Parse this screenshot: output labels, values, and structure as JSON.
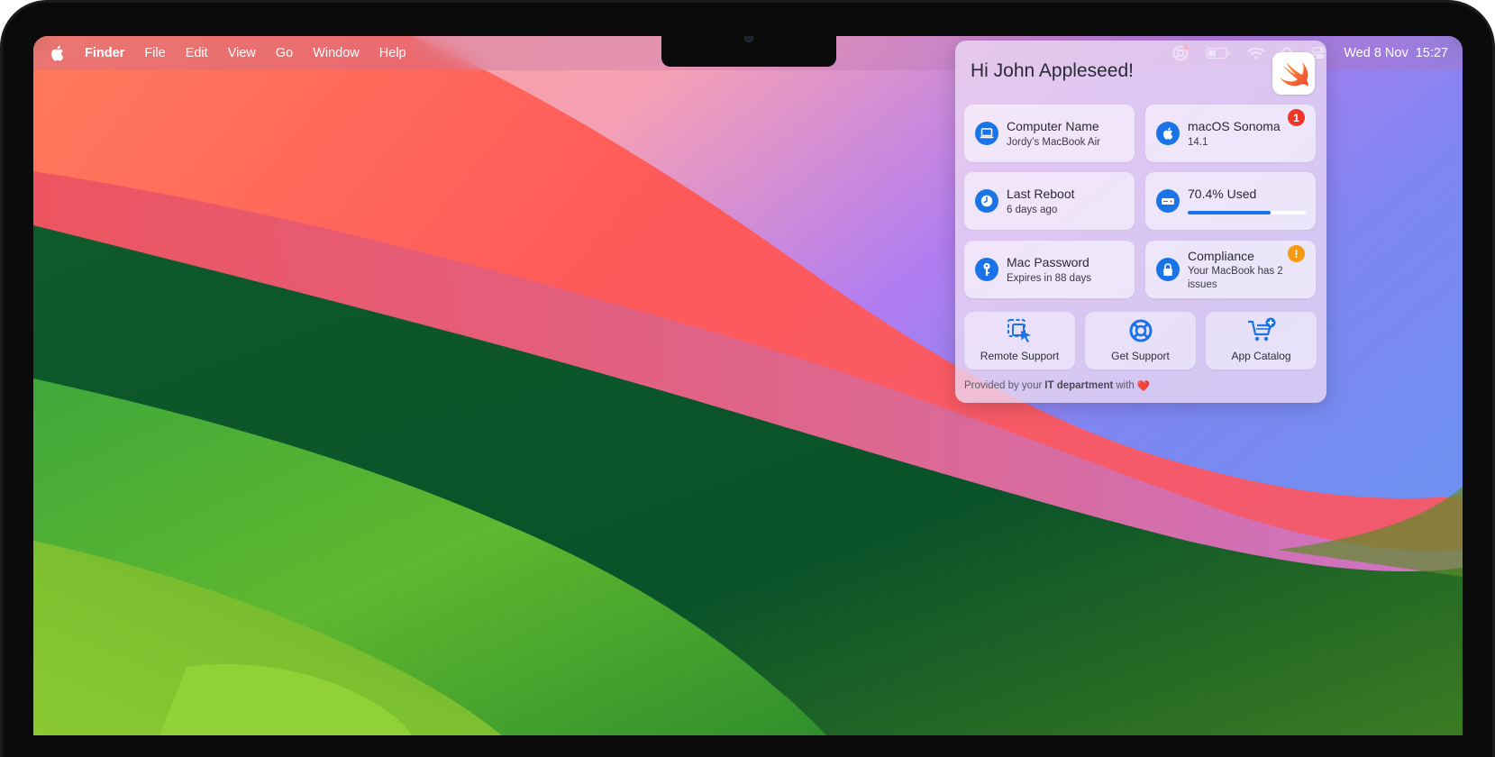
{
  "menubar": {
    "items": [
      "Finder",
      "File",
      "Edit",
      "View",
      "Go",
      "Window",
      "Help"
    ],
    "date": "Wed 8 Nov",
    "time": "15:27",
    "icons": [
      "apple-icon",
      "support-lifebuoy-icon",
      "battery-icon",
      "wifi-icon",
      "search-icon",
      "control-center-icon"
    ]
  },
  "panel": {
    "greeting": "Hi John Appleseed!",
    "logo_icon": "swift-icon",
    "cards": [
      {
        "title": "Computer Name",
        "subtitle": "Jordy’s MacBook Air",
        "icon": "laptop-icon"
      },
      {
        "title": "macOS Sonoma",
        "subtitle": "14.1",
        "icon": "apple-icon",
        "badge": "1"
      },
      {
        "title": "Last Reboot",
        "subtitle": "6 days ago",
        "icon": "clock-icon"
      },
      {
        "title": "70.4% Used",
        "icon": "storage-drive-icon",
        "usage": 0.704
      },
      {
        "title": "Mac Password",
        "subtitle": "Expires in 88 days",
        "icon": "key-icon"
      },
      {
        "title": "Compliance",
        "subtitle": "Your MacBook has 2 issues",
        "icon": "lock-icon",
        "badge": "!"
      }
    ],
    "actions": [
      {
        "label": "Remote Support",
        "icon": "remote-support-icon"
      },
      {
        "label": "Get Support",
        "icon": "lifebuoy-icon"
      },
      {
        "label": "App Catalog",
        "icon": "cart-plus-icon"
      }
    ],
    "footer": {
      "prefix": "Provided by your",
      "department": "IT department",
      "suffix": "with",
      "emoji": "❤️"
    }
  },
  "colors": {
    "accent": "#1a74e8",
    "badge_red": "#f0352b",
    "badge_orange": "#f59a12"
  }
}
